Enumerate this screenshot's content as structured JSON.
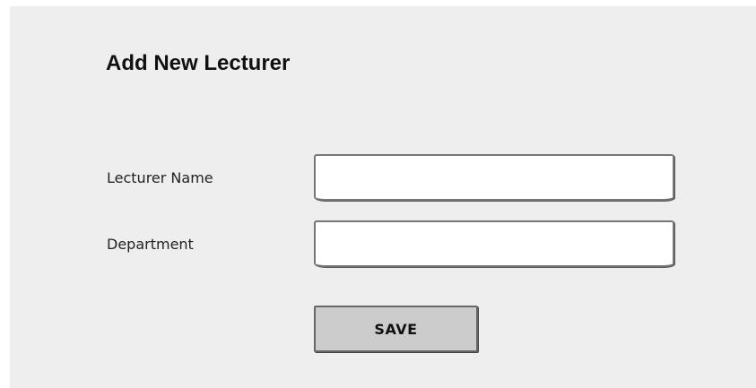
{
  "form": {
    "title": "Add New Lecturer",
    "fields": [
      {
        "label": "Lecturer Name",
        "value": "",
        "placeholder": ""
      },
      {
        "label": "Department",
        "value": "",
        "placeholder": ""
      }
    ],
    "save_label": "SAVE"
  }
}
